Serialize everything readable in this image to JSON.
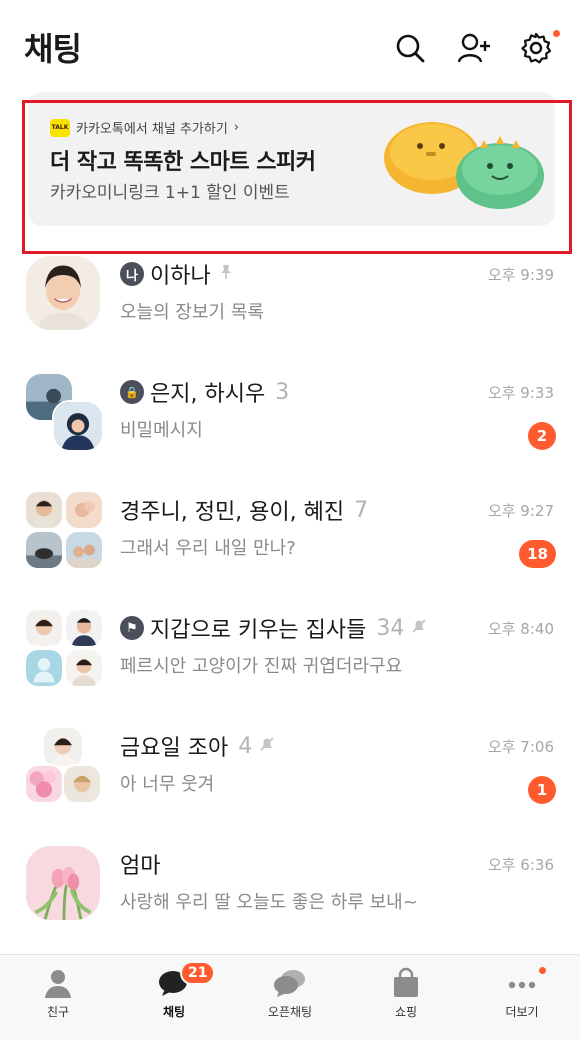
{
  "header": {
    "title": "채팅",
    "icons": [
      "search-icon",
      "add-friend-icon",
      "settings-icon"
    ],
    "settings_has_dot": true
  },
  "banner": {
    "logo_text": "TALK",
    "source": "카카오톡에서 채널 추가하기",
    "source_chevron": "›",
    "title": "더 작고 똑똑한 스마트 스피커",
    "subtitle": "카카오미니링크 1+1 할인 이벤트"
  },
  "chats": [
    {
      "badge_text": "나",
      "name": "이하나",
      "count": "",
      "pinned": true,
      "muted": false,
      "preview": "오늘의 장보기 목록",
      "time": "오후 9:39",
      "unread": ""
    },
    {
      "badge_text": "🔒",
      "name": "은지, 하시우",
      "count": "3",
      "pinned": false,
      "muted": false,
      "preview": "비밀메시지",
      "time": "오후 9:33",
      "unread": "2"
    },
    {
      "badge_text": "",
      "name": "경주니, 정민, 용이, 혜진",
      "count": "7",
      "pinned": false,
      "muted": false,
      "preview": "그래서 우리 내일 만나?",
      "time": "오후 9:27",
      "unread": "18"
    },
    {
      "badge_text": "⚑",
      "name": "지갑으로 키우는 집사들",
      "count": "34",
      "pinned": false,
      "muted": true,
      "preview": "페르시안 고양이가 진짜 귀엽더라구요",
      "time": "오후 8:40",
      "unread": ""
    },
    {
      "badge_text": "",
      "name": "금요일 조아",
      "count": "4",
      "pinned": false,
      "muted": true,
      "preview": "아 너무 웃겨",
      "time": "오후 7:06",
      "unread": "1"
    },
    {
      "badge_text": "",
      "name": "엄마",
      "count": "",
      "pinned": false,
      "muted": false,
      "preview": "사랑해 우리 딸 오늘도 좋은 하루 보내~",
      "time": "오후 6:36",
      "unread": ""
    }
  ],
  "nav": [
    {
      "label": "친구",
      "icon": "person-icon",
      "badge": "",
      "active": false,
      "dot": false
    },
    {
      "label": "채팅",
      "icon": "chat-bubble-icon",
      "badge": "21",
      "active": true,
      "dot": false
    },
    {
      "label": "오픈채팅",
      "icon": "open-chat-icon",
      "badge": "",
      "active": false,
      "dot": false
    },
    {
      "label": "쇼핑",
      "icon": "shopping-bag-icon",
      "badge": "",
      "active": false,
      "dot": false
    },
    {
      "label": "더보기",
      "icon": "more-dots-icon",
      "badge": "",
      "active": false,
      "dot": true
    }
  ],
  "colors": {
    "accent": "#ff5b2e",
    "highlight_frame": "#e0182a",
    "banner_bg": "#f2f2f2",
    "talk_yellow": "#fae100"
  }
}
